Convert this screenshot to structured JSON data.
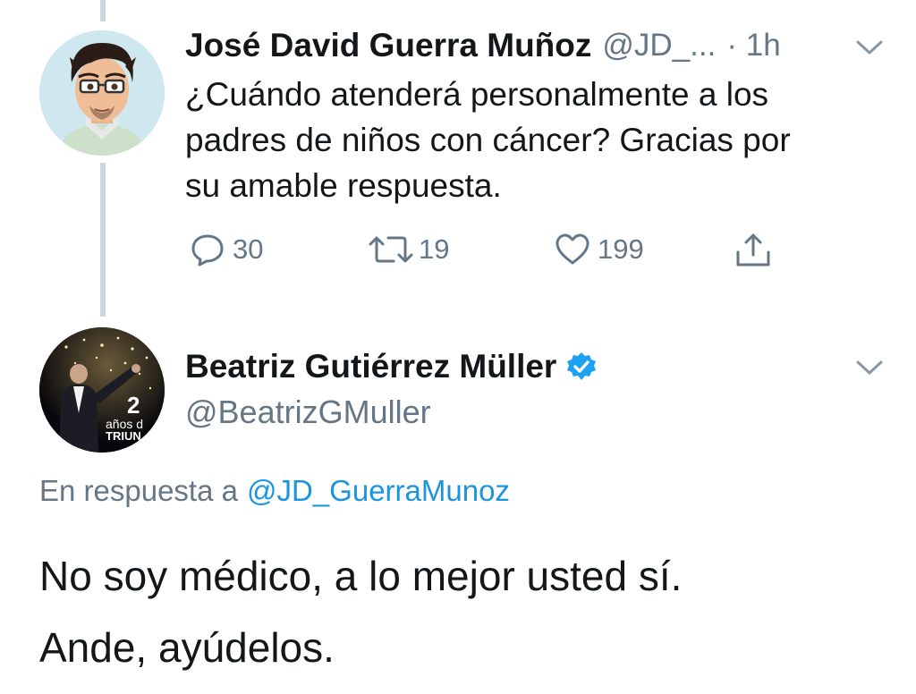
{
  "colors": {
    "text": "#14171a",
    "muted": "#657786",
    "link": "#1b95e0",
    "verified": "#1da1f2",
    "thread_line": "#ccd6dd"
  },
  "parent_tweet": {
    "author_name": "José David Guerra Muñoz",
    "handle": "@JD_...",
    "time": "· 1h",
    "text_lines": [
      "¿Cuándo atenderá personalmente a los",
      "padres de niños con cáncer? Gracias por",
      "su amable respuesta."
    ],
    "reply_count": "30",
    "retweet_count": "19",
    "like_count": "199",
    "icons": [
      "reply-icon",
      "retweet-icon",
      "like-icon",
      "share-icon",
      "chevron-down-icon"
    ]
  },
  "reply_tweet": {
    "author_name": "Beatriz Gutiérrez Müller",
    "handle": "@BeatrizGMuller",
    "verified": true,
    "avatar_badge": {
      "number": "2",
      "line1": "años d",
      "line2": "TRIUN"
    },
    "in_reply_prefix": "En respuesta a",
    "in_reply_handle": "@JD_GuerraMunoz",
    "text_lines": [
      "No soy médico, a lo mejor usted sí.",
      "Ande, ayúdelos."
    ]
  }
}
